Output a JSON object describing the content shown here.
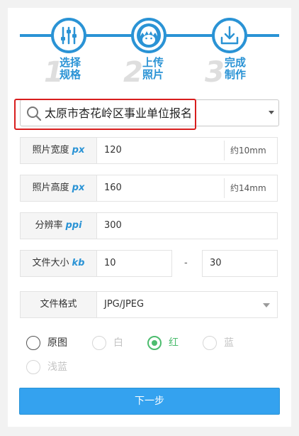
{
  "steps": [
    {
      "num": "1",
      "line1": "选择",
      "line2": "规格",
      "icon": "sliders-icon"
    },
    {
      "num": "2",
      "line1": "上传",
      "line2": "照片",
      "icon": "face-icon"
    },
    {
      "num": "3",
      "line1": "完成",
      "line2": "制作",
      "icon": "download-icon"
    }
  ],
  "search": {
    "value": "太原市杏花岭区事业单位报名"
  },
  "form": {
    "width": {
      "label": "照片宽度",
      "unit": "px",
      "value": "120",
      "hint": "约10mm"
    },
    "height": {
      "label": "照片高度",
      "unit": "px",
      "value": "160",
      "hint": "约14mm"
    },
    "dpi": {
      "label": "分辨率",
      "unit": "ppi",
      "value": "300"
    },
    "filesize": {
      "label": "文件大小",
      "unit": "kb",
      "min": "10",
      "sep": "-",
      "max": "30"
    },
    "format": {
      "label": "文件格式",
      "value": "JPG/JPEG"
    }
  },
  "background_options": [
    {
      "label": "原图",
      "state": "enabled"
    },
    {
      "label": "白",
      "state": "disabled"
    },
    {
      "label": "红",
      "state": "checked"
    },
    {
      "label": "蓝",
      "state": "disabled"
    },
    {
      "label": "浅蓝",
      "state": "disabled"
    }
  ],
  "next_button": "下一步",
  "colors": {
    "accent": "#2a93d5",
    "button": "#34a2ef",
    "checked": "#4cbc6e",
    "highlight": "#d81e1e"
  }
}
